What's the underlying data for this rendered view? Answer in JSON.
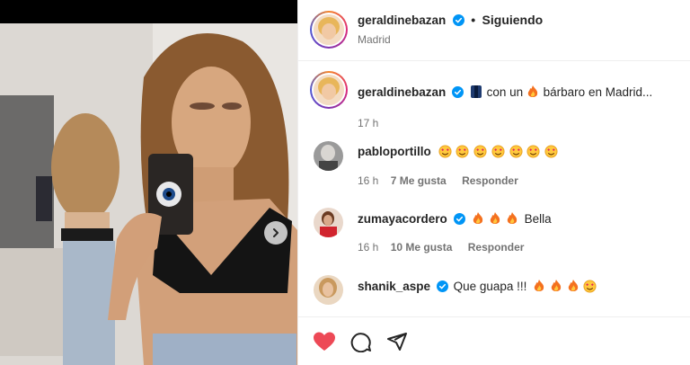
{
  "post": {
    "author": "geraldinebazan",
    "follow_label": "Siguiendo",
    "separator": "•",
    "location": "Madrid"
  },
  "caption": {
    "author": "geraldinebazan",
    "text_before": "con un",
    "text_after": "bárbaro en Madrid...",
    "time": "17 h"
  },
  "comments": [
    {
      "author": "pabloportillo",
      "text": "",
      "time": "16 h",
      "likes": "7 Me gusta",
      "reply": "Responder"
    },
    {
      "author": "zumayacordero",
      "text": "Bella",
      "time": "16 h",
      "likes": "10 Me gusta",
      "reply": "Responder"
    },
    {
      "author": "shanik_aspe",
      "text": "Que guapa !!!",
      "time": "",
      "likes": "",
      "reply": ""
    }
  ],
  "icons": {
    "like": "heart-filled-icon",
    "comment": "comment-bubble-icon",
    "share": "paper-plane-icon",
    "next": "chevron-right-icon",
    "verified": "verified-badge-icon"
  },
  "colors": {
    "like_red": "#ed4956",
    "verified_blue": "#0095f6",
    "muted": "#737373"
  }
}
